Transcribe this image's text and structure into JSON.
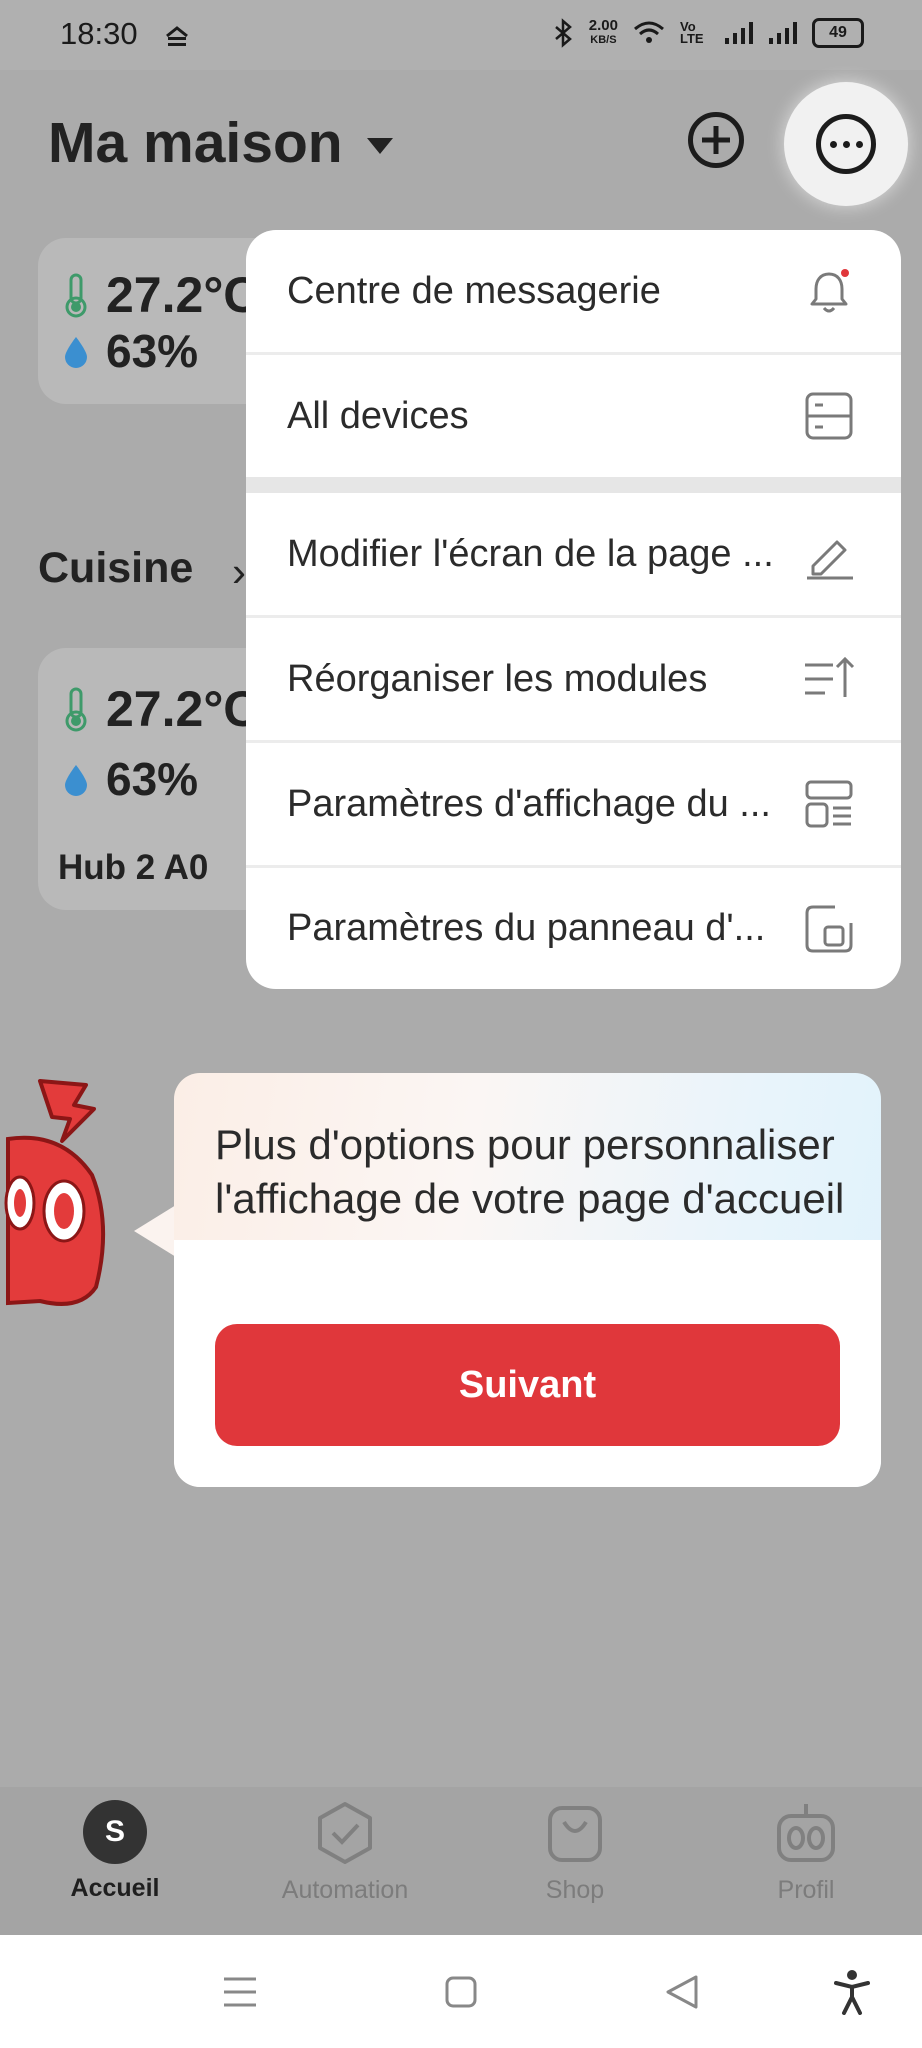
{
  "status_bar": {
    "time": "18:30",
    "speed": "2.00",
    "speed_unit": "KB/S",
    "volte": "Vo LTE",
    "battery": "49"
  },
  "header": {
    "home_name": "Ma maison"
  },
  "summary_card": {
    "temperature": "27.2°C",
    "humidity": "63%"
  },
  "room": {
    "name": "Cuisine",
    "device": {
      "temperature": "27.2°C",
      "humidity": "63%",
      "name": "Hub 2 A0"
    }
  },
  "menu": {
    "items": [
      {
        "label": "Centre de messagerie",
        "icon": "bell-icon"
      },
      {
        "label": "All devices",
        "icon": "devices-icon"
      },
      {
        "label": "Modifier l'écran de la page ...",
        "icon": "pencil-icon"
      },
      {
        "label": "Réorganiser les modules",
        "icon": "reorder-icon"
      },
      {
        "label": "Paramètres d'affichage du ...",
        "icon": "layout-icon"
      },
      {
        "label": "Paramètres du panneau d'...",
        "icon": "panel-icon"
      }
    ]
  },
  "tooltip": {
    "text": "Plus d'options pour personnaliser l'affichage de votre page d'accueil",
    "button_label": "Suivant"
  },
  "bottom_nav": {
    "avatar_initial": "S",
    "items": [
      {
        "label": "Accueil",
        "icon": "avatar-icon",
        "active": true
      },
      {
        "label": "Automation",
        "icon": "automation-icon",
        "active": false
      },
      {
        "label": "Shop",
        "icon": "shop-icon",
        "active": false
      },
      {
        "label": "Profil",
        "icon": "robot-icon",
        "active": false
      }
    ]
  },
  "colors": {
    "accent": "#e0373b",
    "overlay": "#ababab",
    "menu_bg": "#ffffff"
  }
}
